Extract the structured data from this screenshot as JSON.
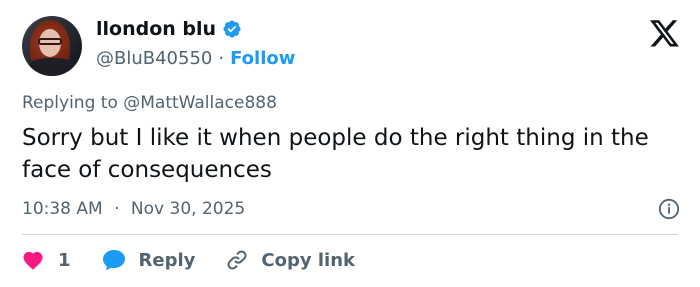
{
  "author": {
    "display_name": "llondon blu",
    "handle": "@BluB40550",
    "separator": "·",
    "follow_label": "Follow",
    "verified_color": "#1d9bf0"
  },
  "reply_to": {
    "prefix": "Replying to",
    "mention": "@MattWallace888"
  },
  "tweet": {
    "text": "Sorry but I like it when people do the right thing in the face of consequences",
    "time": "10:38 AM",
    "separator": "·",
    "date": "Nov 30, 2025"
  },
  "actions": {
    "like_count": "1",
    "reply_label": "Reply",
    "copy_link_label": "Copy link"
  },
  "icons": {
    "like": "heart-icon",
    "reply": "speech-bubble-icon",
    "copy": "link-icon",
    "info": "info-icon",
    "logo": "x-logo-icon",
    "verified": "verified-badge-icon"
  },
  "colors": {
    "heart": "#f91880",
    "reply_bubble": "#1d9bf0",
    "link_blue": "#1d9bf0",
    "secondary_text": "#536471"
  }
}
